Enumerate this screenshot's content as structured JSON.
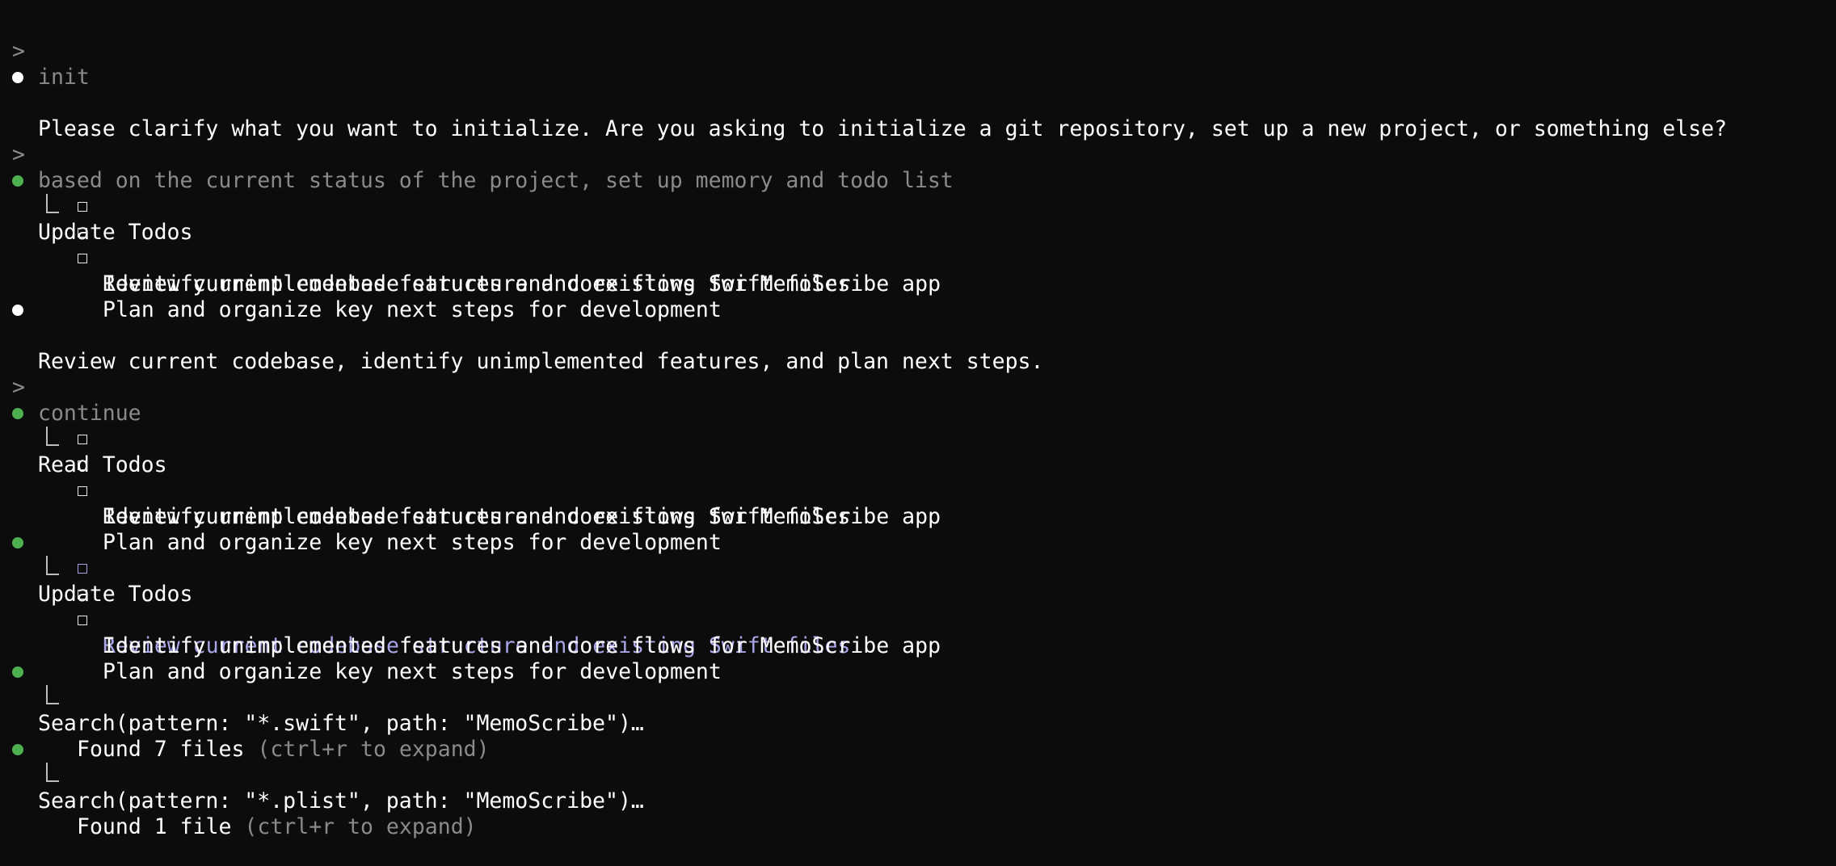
{
  "conversation": {
    "prompt1": "init",
    "reply1": "Please clarify what you want to initialize. Are you asking to initialize a git repository, set up a new project, or something else?",
    "prompt2": "based on the current status of the project, set up memory and todo list",
    "update1": {
      "title": "Update Todos",
      "items": [
        "Review current codebase structure and existing Swift files",
        "Identify unimplemented features and core flows for MemoScribe app",
        "Plan and organize key next steps for development"
      ]
    },
    "reply2": "Review current codebase, identify unimplemented features, and plan next steps.",
    "prompt3": "continue",
    "read1": {
      "title": "Read Todos",
      "items": [
        "Review current codebase structure and existing Swift files",
        "Identify unimplemented features and core flows for MemoScribe app",
        "Plan and organize key next steps for development"
      ]
    },
    "update2": {
      "title": "Update Todos",
      "items": [
        "Review current codebase structure and existing Swift files",
        "Identify unimplemented features and core flows for MemoScribe app",
        "Plan and organize key next steps for development"
      ]
    },
    "search1": {
      "call": "Search(pattern: \"*.swift\", path: \"MemoScribe\")…",
      "result": "Found 7 files",
      "hint": "(ctrl+r to expand)"
    },
    "search2": {
      "call": "Search(pattern: \"*.plist\", path: \"MemoScribe\")…",
      "result": "Found 1 file",
      "hint": "(ctrl+r to expand)"
    }
  },
  "symbols": {
    "prompt_caret": ">"
  },
  "colors": {
    "background": "#0c0c0c",
    "text": "#ffffff",
    "muted": "#8a8a8a",
    "success_bullet": "#4caf50",
    "active_todo": "#a9a6e8"
  }
}
